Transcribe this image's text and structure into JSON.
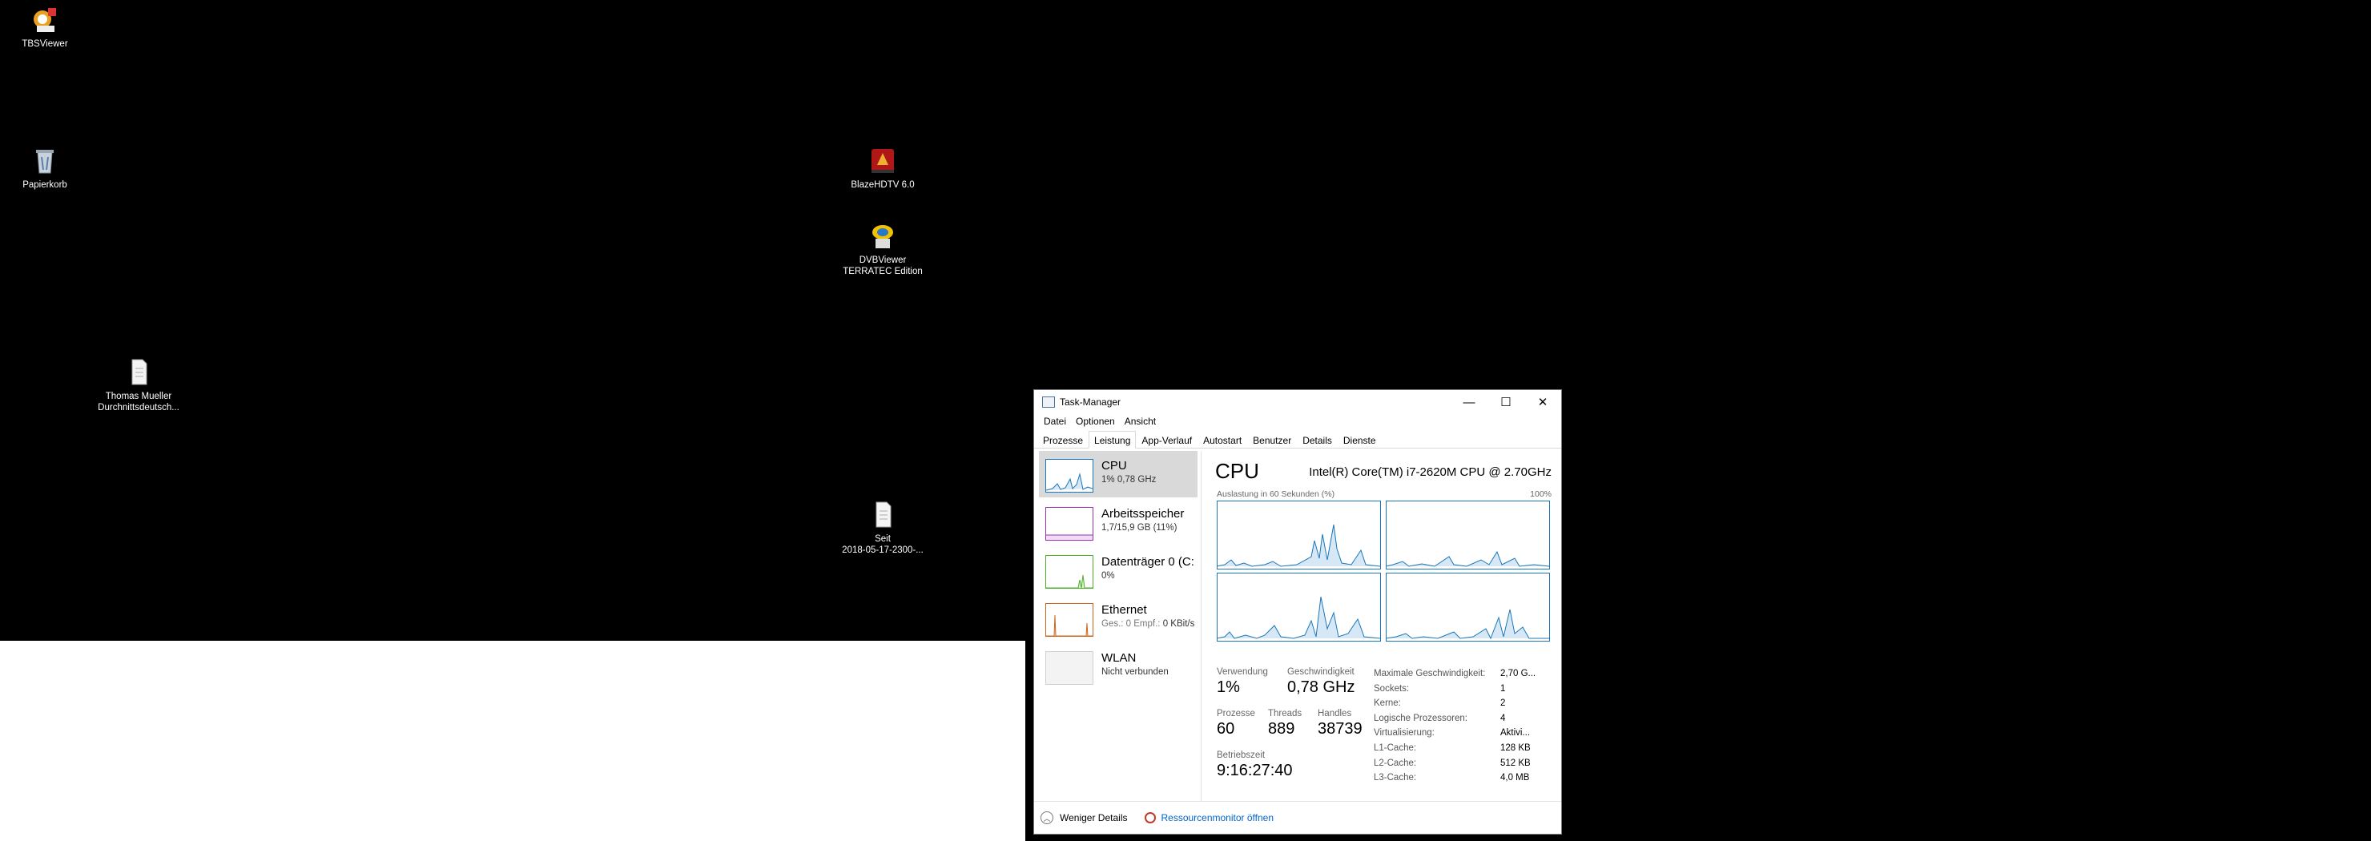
{
  "desktop": {
    "icons": [
      {
        "label": "TBSViewer"
      },
      {
        "label": "Papierkorb"
      },
      {
        "label": "BlazeHDTV 6.0"
      },
      {
        "label": "DVBViewer\nTERRATEC Edition"
      },
      {
        "label": "Thomas Mueller\nDurchnittsdeutsch..."
      },
      {
        "label": "Seit\n2018-05-17-2300-..."
      }
    ]
  },
  "taskmanager": {
    "title": "Task-Manager",
    "window_controls": [
      "—",
      "☐",
      "✕"
    ],
    "menu": [
      "Datei",
      "Optionen",
      "Ansicht"
    ],
    "tabs": [
      "Prozesse",
      "Leistung",
      "App-Verlauf",
      "Autostart",
      "Benutzer",
      "Details",
      "Dienste"
    ],
    "active_tab": "Leistung",
    "sidebar": [
      {
        "title": "CPU",
        "sub": "1% 0,78 GHz",
        "color": "#1a76b8"
      },
      {
        "title": "Arbeitsspeicher",
        "sub": "1,7/15,9 GB (11%)",
        "color": "#9b30b5"
      },
      {
        "title": "Datenträger 0 (C:",
        "sub": "0%",
        "color": "#4caf28"
      },
      {
        "title": "Ethernet",
        "sub_muted": "Ges.: 0 Empf.:",
        "sub": "0 KBit/s",
        "color": "#c8641e"
      },
      {
        "title": "WLAN",
        "sub": "Nicht verbunden",
        "color": "#999999"
      }
    ],
    "main": {
      "heading": "CPU",
      "model": "Intel(R) Core(TM) i7-2620M CPU @ 2.70GHz",
      "util_label": "Auslastung in 60 Sekunden (%)",
      "util_max": "100%",
      "stats": {
        "verwendung_k": "Verwendung",
        "verwendung_v": "1%",
        "geschw_k": "Geschwindigkeit",
        "geschw_v": "0,78 GHz",
        "prozesse_k": "Prozesse",
        "prozesse_v": "60",
        "threads_k": "Threads",
        "threads_v": "889",
        "handles_k": "Handles",
        "handles_v": "38739",
        "betrieb_k": "Betriebszeit",
        "betrieb_v": "9:16:27:40"
      },
      "info": [
        {
          "k": "Maximale Geschwindigkeit:",
          "v": "2,70 G..."
        },
        {
          "k": "Sockets:",
          "v": "1"
        },
        {
          "k": "Kerne:",
          "v": "2"
        },
        {
          "k": "Logische Prozessoren:",
          "v": "4"
        },
        {
          "k": "Virtualisierung:",
          "v": "Aktivi..."
        },
        {
          "k": "L1-Cache:",
          "v": "128 KB"
        },
        {
          "k": "L2-Cache:",
          "v": "512 KB"
        },
        {
          "k": "L3-Cache:",
          "v": "4,0 MB"
        }
      ]
    },
    "footer": {
      "fewer": "Weniger Details",
      "resmon": "Ressourcenmonitor öffnen"
    }
  }
}
